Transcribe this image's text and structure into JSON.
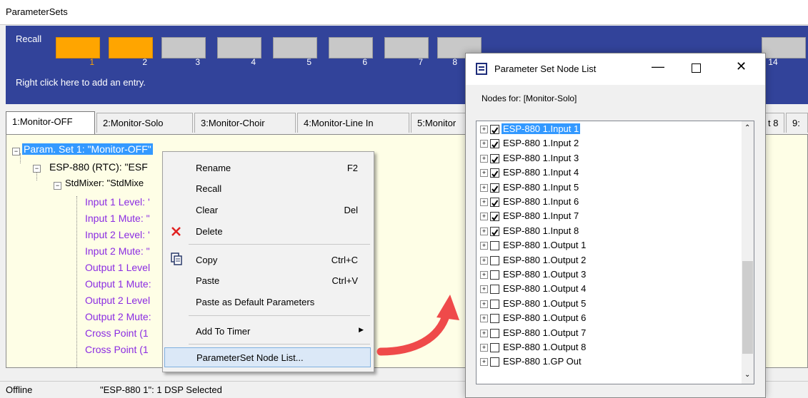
{
  "window": {
    "title": "ParameterSets"
  },
  "recall": {
    "label": "Recall",
    "slots": [
      "1",
      "2",
      "3",
      "4",
      "5",
      "6",
      "7",
      "8",
      "14"
    ],
    "hint": "Right click here to add an entry."
  },
  "tabs": [
    "1:Monitor-OFF",
    "2:Monitor-Solo",
    "3:Monitor-Choir",
    "4:Monitor-Line In",
    "5:Monitor",
    "t 8",
    "9:"
  ],
  "tree": {
    "root": "Param. Set 1: \"Monitor-OFF\"",
    "device": "ESP-880 (RTC): \"ESF",
    "mixer": "StdMixer: \"StdMixe",
    "params": [
      "Input 1 Level: '",
      "Input 1 Mute: \"",
      "Input 2 Level: '",
      "Input 2 Mute: \"",
      "Output 1 Level",
      "Output 1 Mute:",
      "Output 2 Level",
      "Output 2 Mute:",
      "Cross Point (1",
      "Cross Point (1"
    ]
  },
  "status": {
    "left": "Offline",
    "middle": "\"ESP-880 1\": 1 DSP Selected"
  },
  "context_menu": {
    "rename": "Rename",
    "rename_sc": "F2",
    "recall": "Recall",
    "clear": "Clear",
    "clear_sc": "Del",
    "delete": "Delete",
    "copy": "Copy",
    "copy_sc": "Ctrl+C",
    "paste": "Paste",
    "paste_sc": "Ctrl+V",
    "paste_default": "Paste as Default Parameters",
    "add_timer": "Add To Timer",
    "node_list": "ParameterSet Node List..."
  },
  "dialog": {
    "title": "Parameter Set Node List",
    "nodes_for": "Nodes for: [Monitor-Solo]",
    "items": [
      {
        "label": "ESP-880 1.Input 1",
        "checked": true
      },
      {
        "label": "ESP-880 1.Input 2",
        "checked": true
      },
      {
        "label": "ESP-880 1.Input 3",
        "checked": true
      },
      {
        "label": "ESP-880 1.Input 4",
        "checked": true
      },
      {
        "label": "ESP-880 1.Input 5",
        "checked": true
      },
      {
        "label": "ESP-880 1.Input 6",
        "checked": true
      },
      {
        "label": "ESP-880 1.Input 7",
        "checked": true
      },
      {
        "label": "ESP-880 1.Input 8",
        "checked": true
      },
      {
        "label": "ESP-880 1.Output 1",
        "checked": false
      },
      {
        "label": "ESP-880 1.Output 2",
        "checked": false
      },
      {
        "label": "ESP-880 1.Output 3",
        "checked": false
      },
      {
        "label": "ESP-880 1.Output 4",
        "checked": false
      },
      {
        "label": "ESP-880 1.Output 5",
        "checked": false
      },
      {
        "label": "ESP-880 1.Output 6",
        "checked": false
      },
      {
        "label": "ESP-880 1.Output 7",
        "checked": false
      },
      {
        "label": "ESP-880 1.Output 8",
        "checked": false
      },
      {
        "label": "ESP-880 1.GP Out",
        "checked": false
      }
    ]
  }
}
